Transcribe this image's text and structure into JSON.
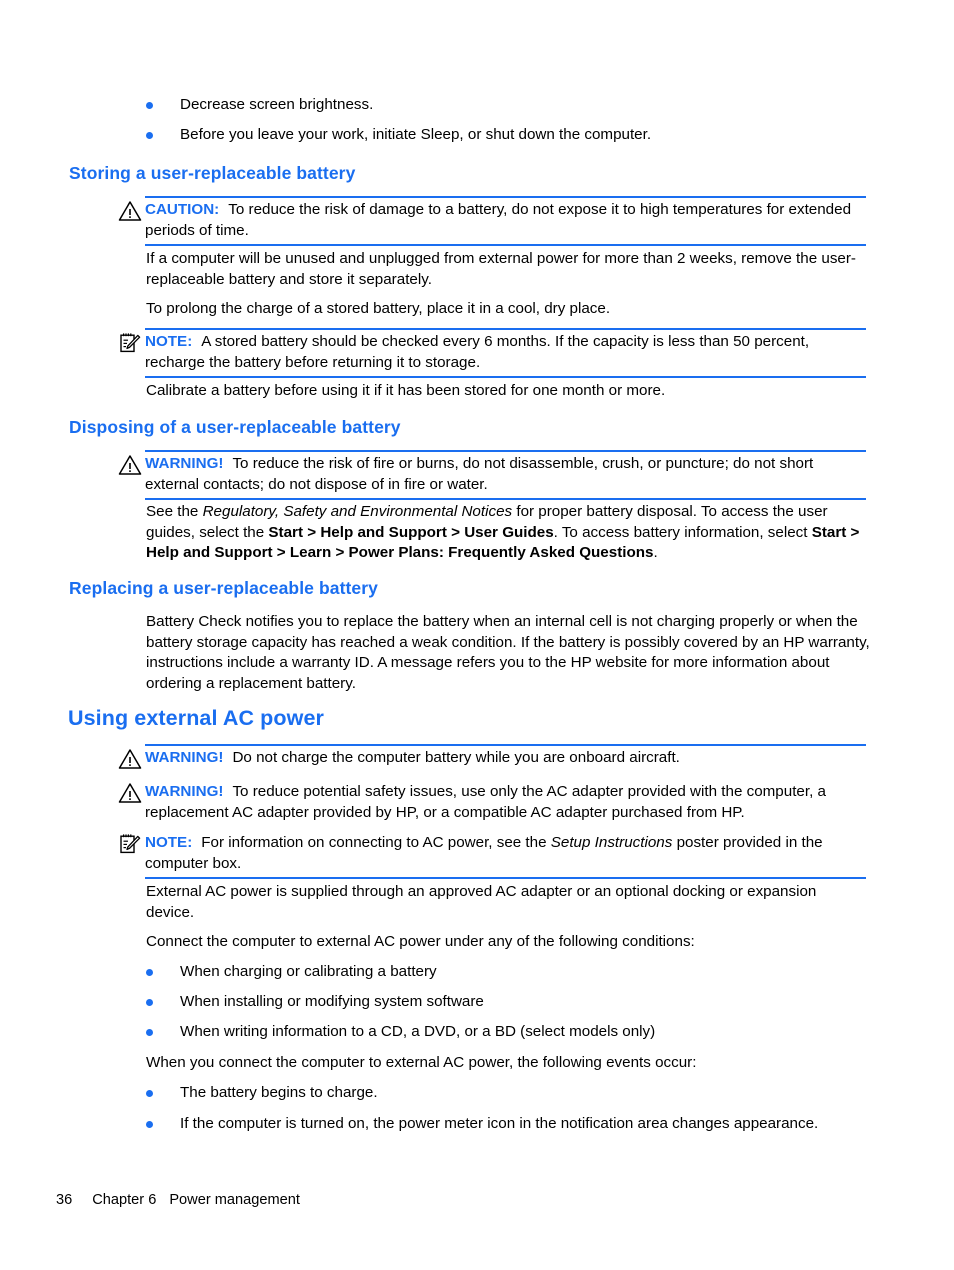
{
  "page": {
    "footer": {
      "page_number": "36",
      "chapter": "Chapter 6",
      "chapter_title": "Power management"
    }
  },
  "colors": {
    "heading_blue": "#1a6ef0",
    "bullet_blue": "#1a6ef0",
    "rule_blue": "#1a6ef0",
    "body_black": "#000000"
  },
  "top_bullets": [
    {
      "text": "Decrease screen brightness."
    },
    {
      "text": "Before you leave your work, initiate Sleep, or shut down the computer."
    }
  ],
  "sections": [
    {
      "id": "storing",
      "heading": "Storing a user-replaceable battery",
      "caution": {
        "icon": "warning-triangle-icon",
        "label": "CAUTION:",
        "text": "To reduce the risk of damage to a battery, do not expose it to high temperatures for extended periods of time."
      },
      "paragraph_1": "If a computer will be unused and unplugged from external power for more than 2 weeks, remove the user-replaceable battery and store it separately.",
      "paragraph_2": "To prolong the charge of a stored battery, place it in a cool, dry place.",
      "note": {
        "icon": "note-pad-pencil-icon",
        "label": "NOTE:",
        "text": "A stored battery should be checked every 6 months. If the capacity is less than 50 percent, recharge the battery before returning it to storage."
      },
      "paragraph_3": "Calibrate a battery before using it if it has been stored for one month or more."
    },
    {
      "id": "disposing",
      "heading": "Disposing of a user-replaceable battery",
      "warning": {
        "icon": "warning-triangle-icon",
        "label": "WARNING!",
        "text": "To reduce the risk of fire or burns, do not disassemble, crush, or puncture; do not short external contacts; do not dispose of in fire or water."
      },
      "paragraph_runs": [
        {
          "text": "See the ",
          "style": "normal"
        },
        {
          "text": "Regulatory, Safety and Environmental Notices",
          "style": "italic"
        },
        {
          "text": " for proper battery disposal. To access the user guides, select the ",
          "style": "normal"
        },
        {
          "text": "Start > Help and Support > User Guides",
          "style": "bold"
        },
        {
          "text": ". To access battery information, select ",
          "style": "normal"
        },
        {
          "text": "Start > Help and Support > Learn > Power Plans: Frequently Asked Questions",
          "style": "bold"
        },
        {
          "text": ".",
          "style": "normal"
        }
      ]
    },
    {
      "id": "replacing",
      "heading": "Replacing a user-replaceable battery",
      "paragraph_1": "Battery Check notifies you to replace the battery when an internal cell is not charging properly or when the battery storage capacity has reached a weak condition. If the battery is possibly covered by an HP warranty, instructions include a warranty ID. A message refers you to the HP website for more information about ordering a replacement battery."
    },
    {
      "id": "using-external-ac-power",
      "heading": "Using external AC power",
      "warning_1": {
        "icon": "warning-triangle-icon",
        "label": "WARNING!",
        "text": "Do not charge the computer battery while you are onboard aircraft."
      },
      "warning_2": {
        "icon": "warning-triangle-icon",
        "label": "WARNING!",
        "text": "To reduce potential safety issues, use only the AC adapter provided with the computer, a replacement AC adapter provided by HP, or a compatible AC adapter purchased from HP."
      },
      "note": {
        "icon": "note-pad-pencil-icon",
        "label": "NOTE:",
        "text_before": "For information on connecting to AC power, see the ",
        "text_italic": "Setup Instructions",
        "text_after": " poster provided in the computer box."
      },
      "paragraph_1": "External AC power is supplied through an approved AC adapter or an optional docking or expansion device.",
      "paragraph_2": "Connect the computer to external AC power under any of the following conditions:",
      "conditions_bullets": [
        {
          "text": "When charging or calibrating a battery"
        },
        {
          "text": "When installing or modifying system software"
        },
        {
          "text": "When writing information to a CD, a DVD, or a BD (select models only)"
        }
      ],
      "paragraph_3": "When you connect the computer to external AC power, the following events occur:",
      "events_bullets": [
        {
          "text": "The battery begins to charge."
        },
        {
          "text": "If the computer is turned on, the power meter icon in the notification area changes appearance."
        }
      ]
    }
  ]
}
